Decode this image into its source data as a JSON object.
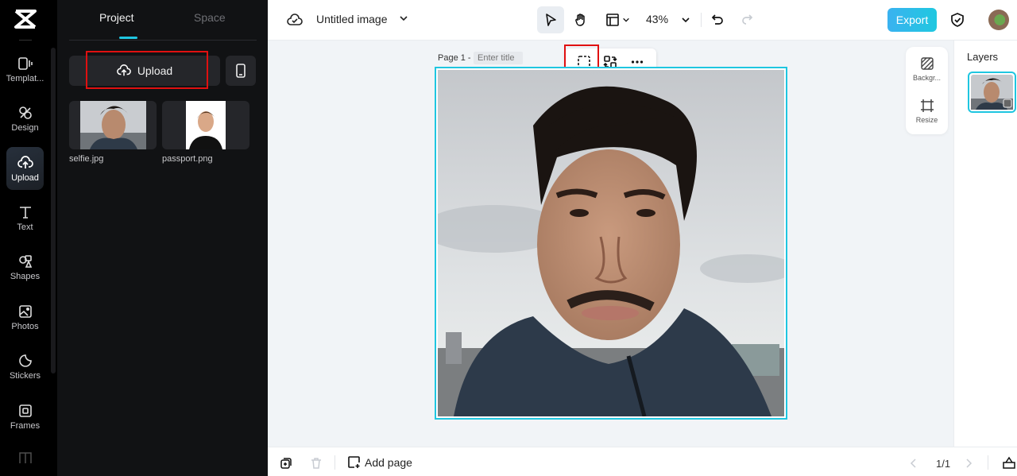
{
  "app": {
    "brand": "CapCut"
  },
  "rail": {
    "items": [
      {
        "id": "templates",
        "label": "Templat...",
        "icon": "template-icon"
      },
      {
        "id": "design",
        "label": "Design",
        "icon": "design-icon"
      },
      {
        "id": "upload",
        "label": "Upload",
        "icon": "cloud-upload-icon",
        "active": true
      },
      {
        "id": "text",
        "label": "Text",
        "icon": "text-icon"
      },
      {
        "id": "shapes",
        "label": "Shapes",
        "icon": "shapes-icon"
      },
      {
        "id": "photos",
        "label": "Photos",
        "icon": "photos-icon"
      },
      {
        "id": "stickers",
        "label": "Stickers",
        "icon": "sticker-icon"
      },
      {
        "id": "frames",
        "label": "Frames",
        "icon": "frame-icon"
      }
    ]
  },
  "panel": {
    "tabs": [
      {
        "label": "Project",
        "active": true
      },
      {
        "label": "Space",
        "active": false
      }
    ],
    "upload_label": "Upload",
    "assets": [
      {
        "name": "selfie.jpg"
      },
      {
        "name": "passport.png"
      }
    ]
  },
  "topbar": {
    "title": "Untitled image",
    "zoom": "43%",
    "export_label": "Export"
  },
  "canvas": {
    "page_label": "Page 1 -",
    "title_placeholder": "Enter title",
    "right_tools": [
      {
        "label": "Backgr...",
        "icon": "background-icon"
      },
      {
        "label": "Resize",
        "icon": "resize-icon"
      }
    ]
  },
  "layers": {
    "title": "Layers"
  },
  "bottombar": {
    "add_page_label": "Add page",
    "page_indicator": "1/1"
  },
  "colors": {
    "accent": "#1fc6e0",
    "highlight": "#e01010",
    "rail_bg": "#000000",
    "panel_bg": "#111214"
  }
}
